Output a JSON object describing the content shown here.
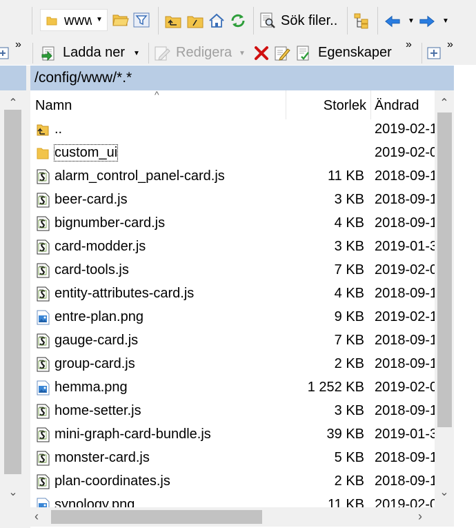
{
  "toolbar": {
    "location_value": "www",
    "search_label": "Sök filer..",
    "download_label": "Ladda ner",
    "edit_label": "Redigera",
    "properties_label": "Egenskaper",
    "overflow_glyph": "»"
  },
  "path": "/config/www/*.*",
  "columns": {
    "name": "Namn",
    "size": "Storlek",
    "modified": "Ändrad"
  },
  "files": [
    {
      "name": "..",
      "size": "",
      "modified": "2019-02-1",
      "icon": "parent-folder-icon"
    },
    {
      "name": "custom_ui",
      "size": "",
      "modified": "2019-02-0",
      "icon": "folder-icon"
    },
    {
      "name": "alarm_control_panel-card.js",
      "size": "11 KB",
      "modified": "2018-09-1",
      "icon": "script-file-icon"
    },
    {
      "name": "beer-card.js",
      "size": "3 KB",
      "modified": "2018-09-1",
      "icon": "script-file-icon"
    },
    {
      "name": "bignumber-card.js",
      "size": "4 KB",
      "modified": "2018-09-1",
      "icon": "script-file-icon"
    },
    {
      "name": "card-modder.js",
      "size": "3 KB",
      "modified": "2019-01-3",
      "icon": "script-file-icon"
    },
    {
      "name": "card-tools.js",
      "size": "7 KB",
      "modified": "2019-02-0",
      "icon": "script-file-icon"
    },
    {
      "name": "entity-attributes-card.js",
      "size": "4 KB",
      "modified": "2018-09-1",
      "icon": "script-file-icon"
    },
    {
      "name": "entre-plan.png",
      "size": "9 KB",
      "modified": "2019-02-1",
      "icon": "image-file-icon"
    },
    {
      "name": "gauge-card.js",
      "size": "7 KB",
      "modified": "2018-09-1",
      "icon": "script-file-icon"
    },
    {
      "name": "group-card.js",
      "size": "2 KB",
      "modified": "2018-09-1",
      "icon": "script-file-icon"
    },
    {
      "name": "hemma.png",
      "size": "1 252 KB",
      "modified": "2019-02-0",
      "icon": "image-file-icon"
    },
    {
      "name": "home-setter.js",
      "size": "3 KB",
      "modified": "2018-09-1",
      "icon": "script-file-icon"
    },
    {
      "name": "mini-graph-card-bundle.js",
      "size": "39 KB",
      "modified": "2019-01-3",
      "icon": "script-file-icon"
    },
    {
      "name": "monster-card.js",
      "size": "5 KB",
      "modified": "2018-09-1",
      "icon": "script-file-icon"
    },
    {
      "name": "plan-coordinates.js",
      "size": "2 KB",
      "modified": "2018-09-1",
      "icon": "script-file-icon"
    },
    {
      "name": "synology.png",
      "size": "11 KB",
      "modified": "2019-02-0",
      "icon": "image-file-icon"
    }
  ],
  "colors": {
    "path_bar": "#b9cde5",
    "toolbar_bg": "#f0f0f0",
    "delete_red": "#d01010",
    "nav_blue": "#2a7de1",
    "refresh_green": "#2e9e3a",
    "folder_yellow": "#f2c44a"
  }
}
